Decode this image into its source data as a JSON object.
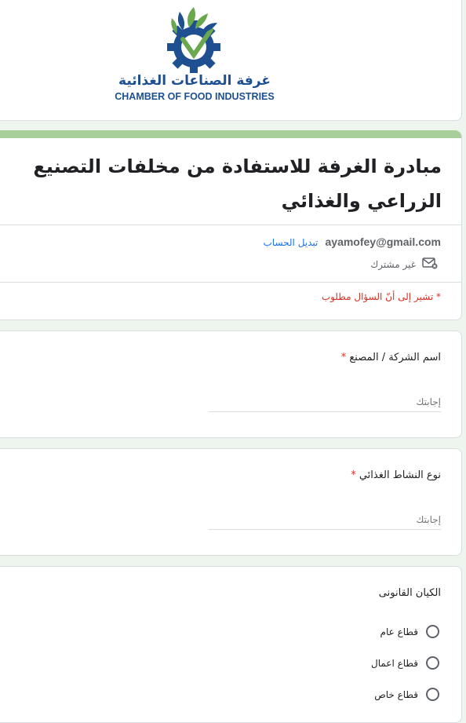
{
  "header": {
    "logo_arabic": "غرفة الصناعات الغذائية",
    "logo_english": "CHAMBER OF FOOD INDUSTRIES",
    "colors": {
      "logo_blue": "#1d4f91",
      "logo_green": "#6aa84f"
    }
  },
  "form": {
    "title": "مبادرة الغرفة للاستفادة من مخلفات التصنيع الزراعي والغذائي",
    "account_email": "ayamofey@gmail.com",
    "switch_account": "تبديل الحساب",
    "share_status": "غير مشترك",
    "share_icon": "mail-off-icon",
    "required_note": "* تشير إلى أنّ السؤال مطلوب",
    "accent_color": "#a8cf9a"
  },
  "questions": [
    {
      "label": "اسم الشركة / المصنع",
      "required_mark": "*",
      "placeholder": "إجابتك"
    },
    {
      "label": "نوع النشاط الغذائي",
      "required_mark": "*",
      "placeholder": "إجابتك"
    },
    {
      "label": "الكيان القانونى",
      "options": [
        "قطاع عام",
        "قطاع اعمال",
        "قطاع خاص"
      ]
    }
  ]
}
